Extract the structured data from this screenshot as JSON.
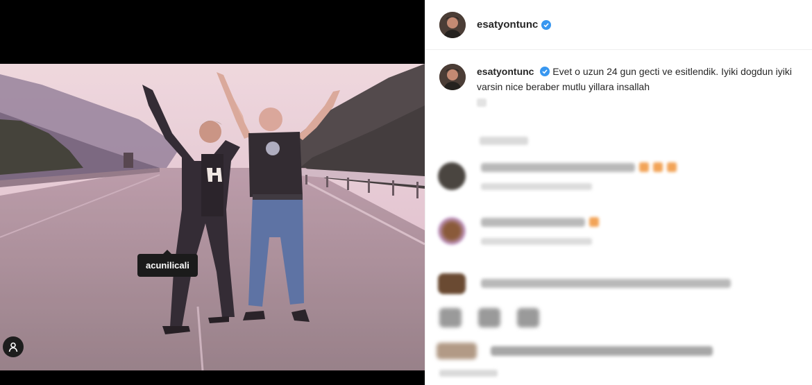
{
  "post": {
    "username": "esatyontunc",
    "verified": true,
    "caption_username": "esatyontunc",
    "caption_text": "Evet o uzun 24 gun gecti ve esitlendik. Iyiki dogdun iyiki varsin nice beraber mutlu yillara insallah",
    "tagged_user": "acunilicali"
  },
  "colors": {
    "verified_blue": "#3897f0",
    "photo_sky": "#e9c9d2",
    "photo_road": "#a59096"
  }
}
